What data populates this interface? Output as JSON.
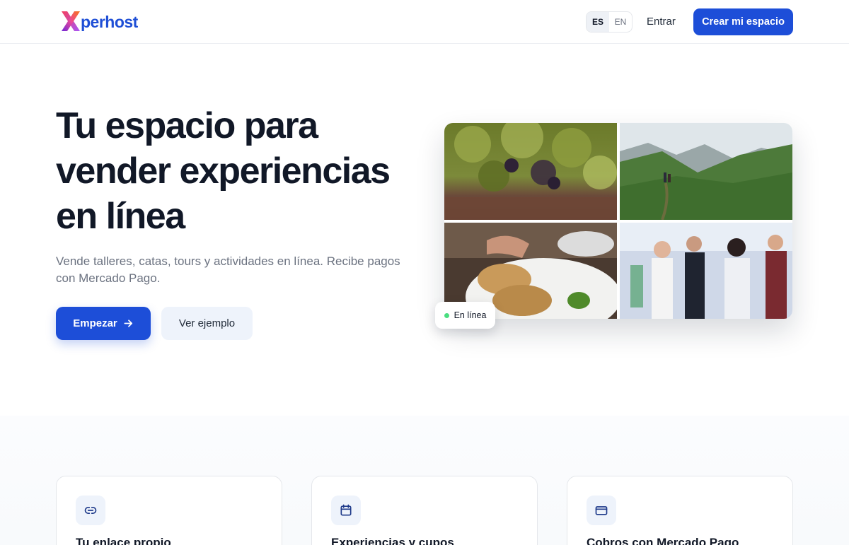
{
  "brand": {
    "name": "perhost",
    "accent": "#1d4ed8"
  },
  "header": {
    "lang_options": [
      "ES",
      "EN"
    ],
    "lang_selected": "ES",
    "login_label": "Entrar",
    "cta_label": "Crear mi espacio"
  },
  "hero": {
    "title": "Tu espacio para vender experiencias en línea",
    "subtitle": "Vende talleres, catas, tours y actividades en línea. Recibe pagos con Mercado Pago.",
    "primary_label": "Empezar",
    "primary_icon": "arrow-right-icon",
    "secondary_label": "Ver ejemplo",
    "status_badge": "En línea",
    "status_color": "#4ade80"
  },
  "features": [
    {
      "icon": "link-icon",
      "title": "Tu enlace propio"
    },
    {
      "icon": "calendar-icon",
      "title": "Experiencias y cupos"
    },
    {
      "icon": "credit-card-icon",
      "title": "Cobros con Mercado Pago"
    }
  ]
}
